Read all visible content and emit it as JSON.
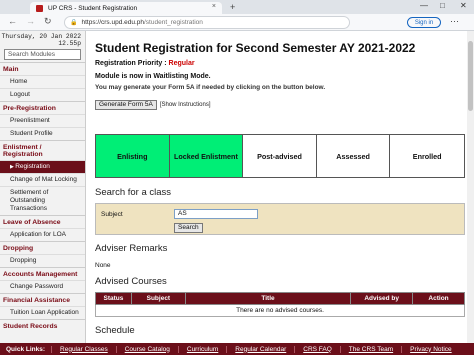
{
  "browser": {
    "tab_title": "UP CRS - Student Registration",
    "tab_close": "×",
    "new_tab": "+",
    "url_domain": "https://crs.upd.edu.ph",
    "url_path": "/student_registration",
    "sign_in": "Sign in",
    "icons": [
      "minimize-icon",
      "maximize-icon",
      "close-icon",
      "back-icon",
      "forward-icon",
      "reload-icon",
      "lock-icon",
      "more-icon"
    ]
  },
  "sidebar": {
    "date_line": "Thursday, 20 Jan 2022",
    "time_line": "12.55p",
    "search_placeholder": "Search Modules",
    "sections": [
      {
        "title": "Main",
        "items": [
          "Home",
          "Logout"
        ]
      },
      {
        "title": "Pre-Registration",
        "items": [
          "Preenlistment",
          "Student Profile"
        ]
      },
      {
        "title": "Enlistment / Registration",
        "items": [
          "Registration",
          "Change of Mat Locking",
          "Settlement of Outstanding Transactions"
        ]
      },
      {
        "title": "Leave of Absence",
        "items": [
          "Application for LOA"
        ]
      },
      {
        "title": "Dropping",
        "items": [
          "Dropping"
        ]
      },
      {
        "title": "Accounts Management",
        "items": [
          "Change Password"
        ]
      },
      {
        "title": "Financial Assistance",
        "items": [
          "Tuition Loan Application"
        ]
      },
      {
        "title": "Student Records",
        "items": []
      }
    ]
  },
  "main": {
    "title": "Student Registration for Second Semester AY 2021-2022",
    "priority_label": "Registration Priority :",
    "priority_value": "Regular",
    "waitlist_text": "Module is now in Waitlisting Mode.",
    "sub_text": "You may generate your Form 5A if needed by clicking on the button below.",
    "generate_button": "Generate Form 5A",
    "show_instructions": "[Show Instructions]",
    "steps": [
      {
        "label": "Enlisting",
        "color": "#00ee76"
      },
      {
        "label": "Locked Enlistment",
        "color": "#00ee76"
      },
      {
        "label": "Post-advised",
        "color": "#ffffff"
      },
      {
        "label": "Assessed",
        "color": "#ffffff"
      },
      {
        "label": "Enrolled",
        "color": "#ffffff"
      }
    ],
    "search_heading": "Search for a class",
    "subject_label": "Subject",
    "subject_value": "AS",
    "search_button": "Search",
    "adviser_heading": "Adviser Remarks",
    "adviser_text": "None",
    "advised_heading": "Advised Courses",
    "table_headers": [
      "Status",
      "Subject",
      "Title",
      "Advised by",
      "Action"
    ],
    "table_empty": "There are no advised courses.",
    "schedule_heading": "Schedule"
  },
  "footer": {
    "quick_links": "Quick Links:",
    "links": [
      "Regular Classes",
      "Course Catalog",
      "Curriculum",
      "Regular Calendar",
      "CRS FAQ",
      "The CRS Team",
      "Privacy Notice"
    ]
  },
  "colors": {
    "maroon": "#6b0f1a",
    "green": "#00ee76",
    "beige": "#efe3c0"
  }
}
